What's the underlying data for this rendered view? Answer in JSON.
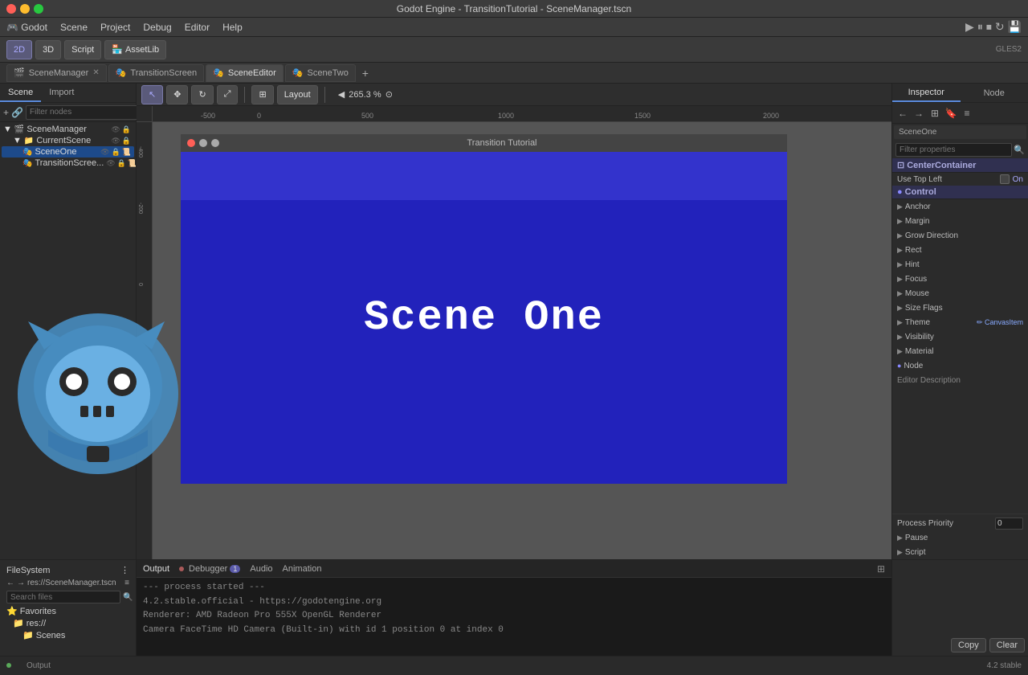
{
  "titlebar": {
    "title": "Godot Engine - TransitionTutorial - SceneManager.tscn"
  },
  "menubar": {
    "items": [
      "Scene",
      "Project",
      "Debug",
      "Editor",
      "Help"
    ]
  },
  "toolbar": {
    "mode_2d": "2D",
    "mode_3d": "3D",
    "script": "Script",
    "assetlib": "AssetLib",
    "gles2": "GLES2",
    "play": "▶",
    "pause": "⏸",
    "stop": "⏹",
    "loop": "↻",
    "save": "💾"
  },
  "left_panel": {
    "scene_tab": "Scene",
    "import_tab": "Import",
    "filter_placeholder": "Filter nodes",
    "nodes": [
      {
        "name": "SceneManager",
        "depth": 0,
        "icon": "🎬"
      },
      {
        "name": "CurrentScene",
        "depth": 1,
        "icon": "📁"
      },
      {
        "name": "SceneOne",
        "depth": 2,
        "icon": "🎭",
        "selected": true
      },
      {
        "name": "TransitionScree...",
        "depth": 2,
        "icon": "🎭"
      }
    ]
  },
  "tabs": [
    {
      "label": "SceneManager",
      "active": false,
      "closeable": true,
      "icon": "🎬"
    },
    {
      "label": "TransitionScreen",
      "active": false,
      "closeable": false,
      "icon": "🎭"
    },
    {
      "label": "SceneEditor",
      "active": true,
      "closeable": false,
      "icon": "🎭"
    },
    {
      "label": "SceneTwo",
      "active": false,
      "closeable": false,
      "icon": "🎭"
    }
  ],
  "viewport": {
    "zoom": "265.3 %",
    "game_title": "Transition Tutorial",
    "scene_text": "Scene One"
  },
  "viewport_tools": {
    "select": "↖",
    "move": "✥",
    "rotate": "↻",
    "scale": "⤢",
    "layout": "Layout"
  },
  "inspector": {
    "inspector_tab": "Inspector",
    "node_tab": "Node",
    "breadcrumb": "SceneOne",
    "filter_placeholder": "Filter properties",
    "current_section": "CenterContainer",
    "use_top_left_label": "Use Top Left",
    "use_top_left_value": "On",
    "sections": {
      "control": "Control",
      "canvas_item": "CanvasItem",
      "node": "Node"
    },
    "properties": [
      {
        "name": "Anchor",
        "has_children": true
      },
      {
        "name": "Margin",
        "has_children": true
      },
      {
        "name": "Grow Direction",
        "has_children": true
      },
      {
        "name": "Rect",
        "has_children": true
      },
      {
        "name": "Hint",
        "has_children": true
      },
      {
        "name": "Focus",
        "has_children": true
      },
      {
        "name": "Mouse",
        "has_children": true
      },
      {
        "name": "Size Flags",
        "has_children": true
      },
      {
        "name": "Theme",
        "has_children": true
      },
      {
        "name": "Visibility",
        "has_children": true
      },
      {
        "name": "Material",
        "has_children": true
      }
    ],
    "canvas_item_sub": "CanvasItem",
    "node_item": "Node",
    "editor_description": "Editor Description",
    "process_priority_label": "Process Priority",
    "process_priority_value": "0",
    "pause_item": "Pause",
    "script_item": "Script"
  },
  "filesystem": {
    "header": "FileSystem",
    "path": "res://SceneManager.tscn",
    "search_placeholder": "Search files",
    "favorites": "Favorites",
    "res_folder": "res://",
    "scenes_folder": "Scenes"
  },
  "bottom_panel": {
    "tabs": [
      {
        "label": "Output",
        "active": true
      },
      {
        "label": "Debugger",
        "badge": "1",
        "active": false
      },
      {
        "label": "Audio",
        "active": false
      },
      {
        "label": "Animation",
        "active": false
      }
    ],
    "log_lines": [
      "--- process started ---",
      "4.2.stable.official - https://godotengine.org",
      "Renderer: AMD Radeon Pro 555X OpenGL Renderer",
      "Camera FaceTime HD Camera (Built-in) with id 1 position 0 at index 0"
    ]
  },
  "statusbar": {
    "version": "4.2 stable",
    "layout_btn": "⊞"
  },
  "copy_button": "Copy",
  "clear_button": "Clear"
}
